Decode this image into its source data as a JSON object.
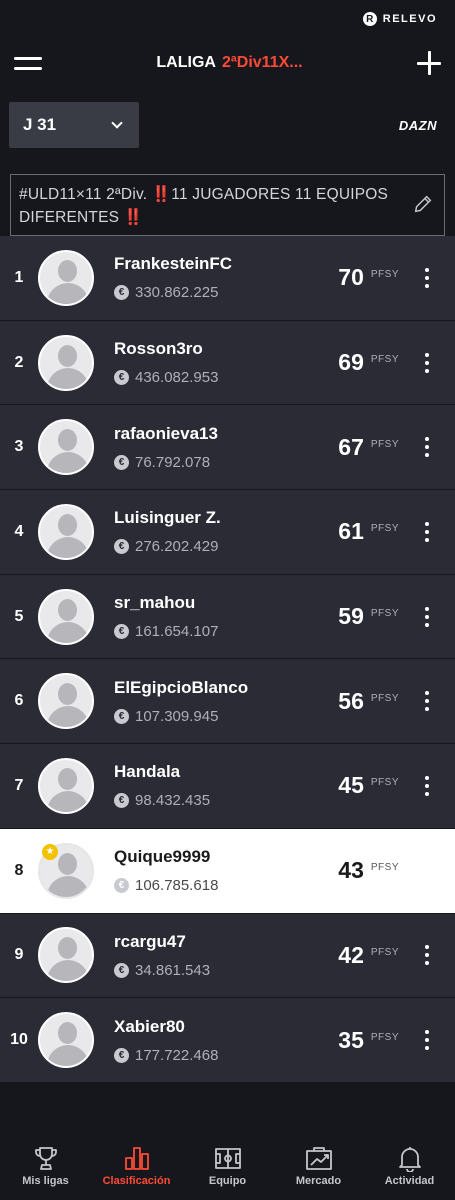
{
  "brand": {
    "name": "RELEVO",
    "logo_letter": "R"
  },
  "header": {
    "title_main": "LALIGA",
    "title_accent": "2ªDiv11X..."
  },
  "round": {
    "label": "J 31"
  },
  "broadcaster": "DAZN",
  "description": "#ULD11×11 2ªDiv. ‼️11 JUGADORES 11 EQUIPOS DIFERENTES ‼️",
  "points_unit": "PFSY",
  "ranking": [
    {
      "pos": "1",
      "name": "FrankesteinFC",
      "value": "330.862.225",
      "points": "70"
    },
    {
      "pos": "2",
      "name": "Rosson3ro",
      "value": "436.082.953",
      "points": "69"
    },
    {
      "pos": "3",
      "name": "rafaonieva13",
      "value": "76.792.078",
      "points": "67"
    },
    {
      "pos": "4",
      "name": "Luisinguer Z.",
      "value": "276.202.429",
      "points": "61"
    },
    {
      "pos": "5",
      "name": "sr_mahou",
      "value": "161.654.107",
      "points": "59"
    },
    {
      "pos": "6",
      "name": "ElEgipcioBlanco",
      "value": "107.309.945",
      "points": "56"
    },
    {
      "pos": "7",
      "name": "Handala",
      "value": "98.432.435",
      "points": "45"
    },
    {
      "pos": "8",
      "name": "Quique9999",
      "value": "106.785.618",
      "points": "43",
      "highlighted": true
    },
    {
      "pos": "9",
      "name": "rcargu47",
      "value": "34.861.543",
      "points": "42"
    },
    {
      "pos": "10",
      "name": "Xabier80",
      "value": "177.722.468",
      "points": "35"
    }
  ],
  "nav": [
    {
      "label": "Mis ligas",
      "icon": "trophy-icon"
    },
    {
      "label": "Clasificación",
      "icon": "bar-chart-icon",
      "active": true
    },
    {
      "label": "Equipo",
      "icon": "pitch-icon"
    },
    {
      "label": "Mercado",
      "icon": "market-icon"
    },
    {
      "label": "Actividad",
      "icon": "bell-icon"
    }
  ],
  "colors": {
    "accent": "#ff4b36",
    "background": "#16171d",
    "row": "#2a2b35",
    "highlight_row": "#ffffff",
    "badge": "#f2c200"
  }
}
